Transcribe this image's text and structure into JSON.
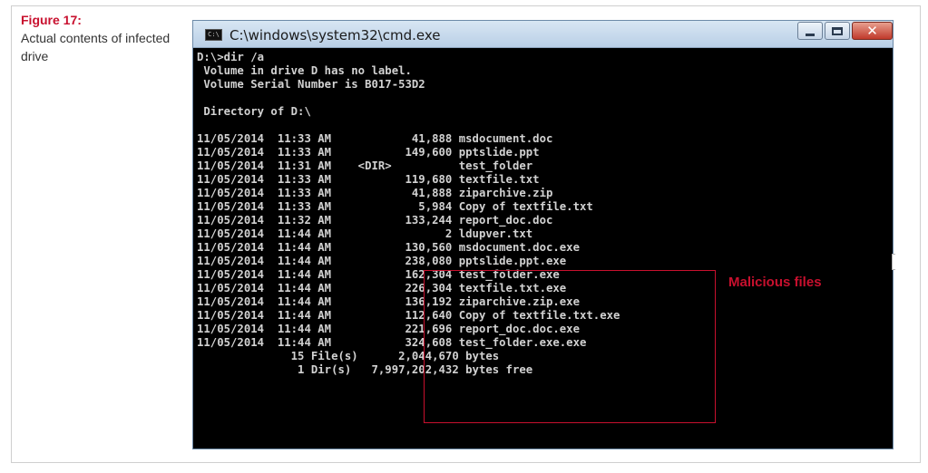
{
  "figure": {
    "label": "Figure 17:",
    "caption": "Actual contents of infected drive"
  },
  "window": {
    "title": "C:\\windows\\system32\\cmd.exe",
    "icon": "cmd-icon",
    "icon_text": "C:\\"
  },
  "console": {
    "lines": [
      "D:\\>dir /a",
      " Volume in drive D has no label.",
      " Volume Serial Number is B017-53D2",
      "",
      " Directory of D:\\",
      "",
      "11/05/2014  11:33 AM            41,888 msdocument.doc",
      "11/05/2014  11:33 AM           149,600 pptslide.ppt",
      "11/05/2014  11:31 AM    <DIR>          test_folder",
      "11/05/2014  11:33 AM           119,680 textfile.txt",
      "11/05/2014  11:33 AM            41,888 ziparchive.zip",
      "11/05/2014  11:33 AM             5,984 Copy of textfile.txt",
      "11/05/2014  11:32 AM           133,244 report_doc.doc",
      "11/05/2014  11:44 AM                 2 ldupver.txt",
      "11/05/2014  11:44 AM           130,560 msdocument.doc.exe",
      "11/05/2014  11:44 AM           238,080 pptslide.ppt.exe",
      "11/05/2014  11:44 AM           162,304 test_folder.exe",
      "11/05/2014  11:44 AM           226,304 textfile.txt.exe",
      "11/05/2014  11:44 AM           136,192 ziparchive.zip.exe",
      "11/05/2014  11:44 AM           112,640 Copy of textfile.txt.exe",
      "11/05/2014  11:44 AM           221,696 report_doc.doc.exe",
      "11/05/2014  11:44 AM           324,608 test_folder.exe.exe",
      "              15 File(s)      2,044,670 bytes",
      "               1 Dir(s)   7,997,202,432 bytes free"
    ]
  },
  "annotation": {
    "label": "Malicious files",
    "color": "#c8102e"
  }
}
